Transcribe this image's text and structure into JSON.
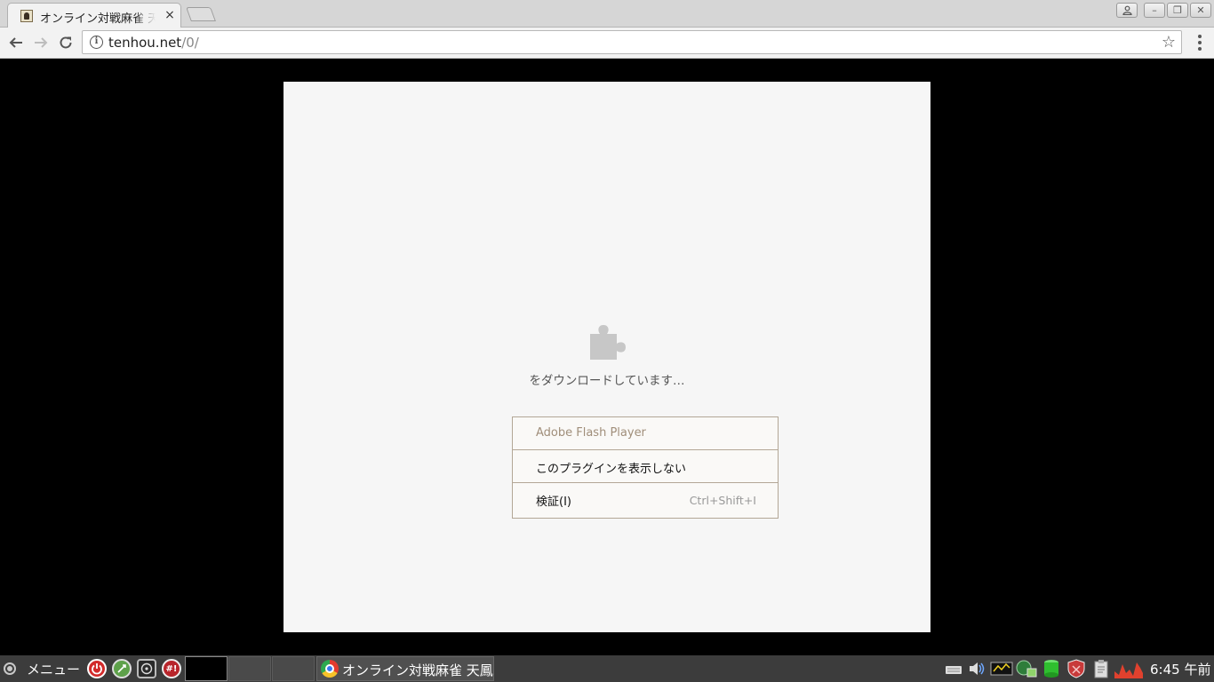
{
  "browser": {
    "tab": {
      "title": "オンライン対戦麻雀 天鳳",
      "close_glyph": "×"
    },
    "omnibox": {
      "url_host": "tenhou.net",
      "url_path": "/0/",
      "info_glyph": "i",
      "star_glyph": "☆"
    },
    "window_controls": {
      "minimize_glyph": "–",
      "restore_glyph": "❐",
      "close_glyph": "✕"
    }
  },
  "plugin": {
    "status_text": "をダウンロードしています…",
    "context_menu": {
      "header": "Adobe Flash Player",
      "hide_label": "このプラグインを表示しない",
      "inspect_label": "検証(I)",
      "inspect_shortcut": "Ctrl+Shift+I"
    }
  },
  "taskbar": {
    "start_label": "メニュー",
    "hash_launcher_glyph": "#!",
    "task_title": "オンライン対戦麻雀 天鳳",
    "clock": "6:45 午前"
  },
  "colors": {
    "page_background": "#000000",
    "plugin_background": "#f6f6f6",
    "taskbar": "#3c3c3c",
    "menu_border": "#b3a796"
  }
}
